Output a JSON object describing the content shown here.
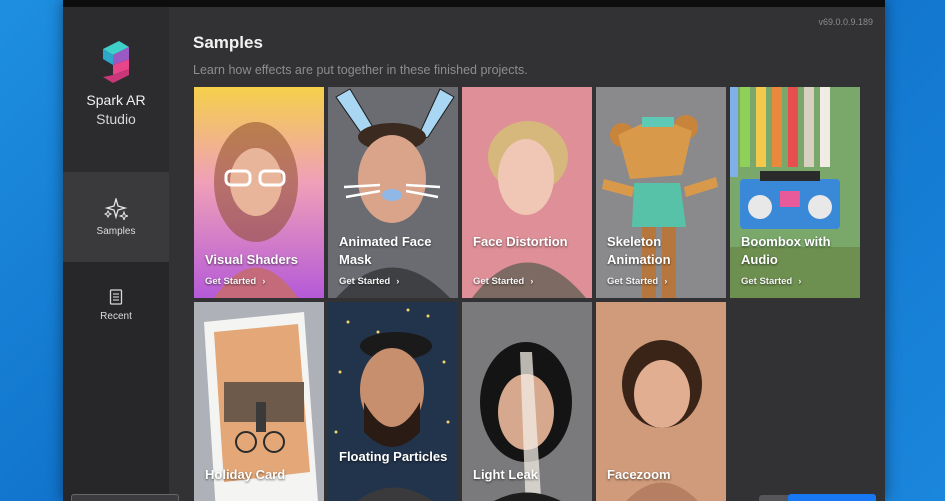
{
  "app": {
    "brand_line1": "Spark AR",
    "brand_line2": "Studio",
    "version": "v69.0.0.9.189"
  },
  "sidebar": {
    "items": [
      {
        "label": "Samples",
        "icon": "sparkles-icon",
        "active": true
      },
      {
        "label": "Recent",
        "icon": "document-icon",
        "active": false
      }
    ]
  },
  "main": {
    "title": "Samples",
    "subtitle": "Learn how effects are put together in these finished projects.",
    "get_started": "Get Started",
    "cards": [
      {
        "label": "Visual Shaders",
        "get_started": true
      },
      {
        "label": "Animated Face Mask",
        "get_started": true
      },
      {
        "label": "Face Distortion",
        "get_started": true
      },
      {
        "label": "Skeleton Animation",
        "get_started": true
      },
      {
        "label": "Boombox with Audio",
        "get_started": true
      },
      {
        "label": "Holiday Card",
        "get_started": false
      },
      {
        "label": "Floating Particles",
        "get_started": false
      },
      {
        "label": "Light Leak",
        "get_started": false
      },
      {
        "label": "Facezoom",
        "get_started": false
      }
    ]
  },
  "colors": {
    "accent_blue": "#1877f2",
    "logo_teal": "#3fd0c9",
    "logo_pink": "#e8458b"
  }
}
